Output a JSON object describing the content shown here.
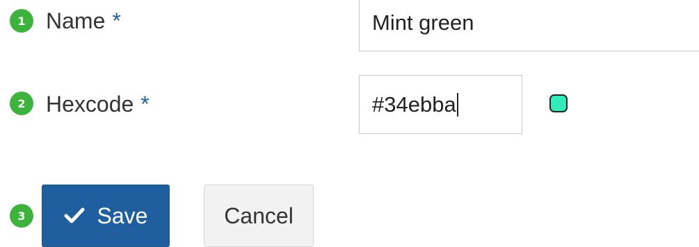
{
  "steps": [
    "1",
    "2",
    "3"
  ],
  "form": {
    "name_label": "Name",
    "name_value": "Mint green",
    "hex_label": "Hexcode",
    "hex_value": "#34ebba",
    "required_mark": "*"
  },
  "colors": {
    "swatch": "#34ebba",
    "step_badge": "#3cb43c",
    "primary_button": "#1f5f9f",
    "required_mark": "#1d5f9a"
  },
  "icons": {
    "save": "checkmark-icon"
  },
  "actions": {
    "save_label": "Save",
    "cancel_label": "Cancel"
  }
}
